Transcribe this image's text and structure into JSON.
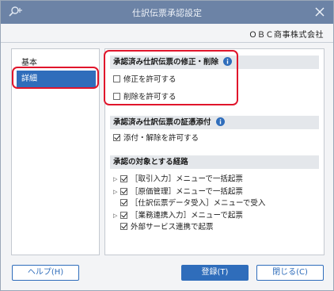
{
  "window": {
    "title": "仕訳伝票承認設定",
    "company": "ＯＢＣ商事株式会社"
  },
  "sidebar": {
    "items": [
      {
        "label": "基本"
      },
      {
        "label": "詳細"
      }
    ]
  },
  "sections": {
    "modify": {
      "title": "承認済み仕訳伝票の修正・削除",
      "options": [
        {
          "label": "修正を許可する",
          "checked": false
        },
        {
          "label": "削除を許可する",
          "checked": false
        }
      ]
    },
    "attach": {
      "title": "承認済み仕訳伝票の証憑添付",
      "options": [
        {
          "label": "添付・解除を許可する",
          "checked": true
        }
      ]
    },
    "routes": {
      "title": "承認の対象とする経路",
      "items": [
        {
          "label": "［取引入力］メニューで一括起票",
          "checked": true,
          "expandable": true
        },
        {
          "label": "［原価管理］メニューで一括起票",
          "checked": true,
          "expandable": true
        },
        {
          "label": "［仕訳伝票データ受入］メニューで受入",
          "checked": true,
          "expandable": false
        },
        {
          "label": "［業務連携入力］メニューで起票",
          "checked": true,
          "expandable": true
        },
        {
          "label": "外部サービス連携で起票",
          "checked": true,
          "expandable": false
        }
      ]
    }
  },
  "buttons": {
    "help": "ヘルプ(H)",
    "save": "登録(T)",
    "close": "閉じる(C)"
  },
  "colors": {
    "titlebar": "#6c83a6",
    "accent": "#2f6dbb",
    "highlight": "#e0152b",
    "info": "#2f6dbb"
  },
  "icons": {
    "app": "search-plus-icon",
    "close": "close-icon",
    "info": "info-icon"
  }
}
